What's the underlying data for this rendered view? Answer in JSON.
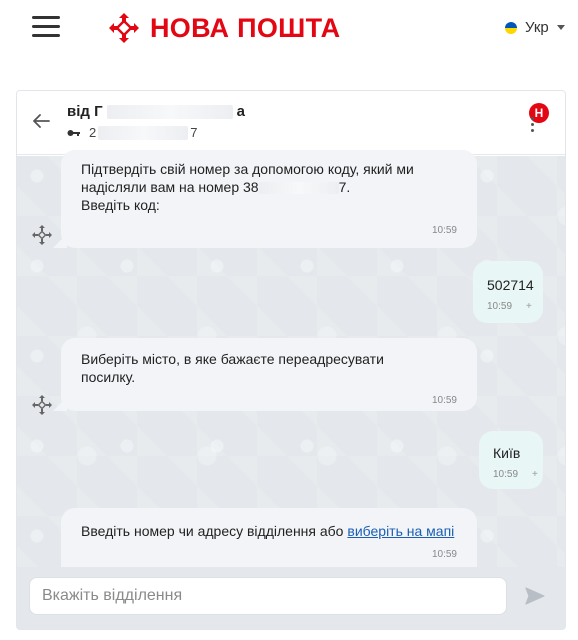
{
  "header": {
    "brand": "НОВА ПОШТА",
    "language": "Укр",
    "brand_color": "#e30613"
  },
  "chat": {
    "from_prefix": "від Г",
    "from_suffix": "а",
    "ttn_prefix": "2",
    "ttn_suffix": "7",
    "badge": "Н",
    "messages": [
      {
        "line1": "Підтвердіть свій номер за допомогою коду, який ми",
        "line2_prefix": "надісляли вам на номер 38",
        "line2_suffix": "7.",
        "line3": "Введіть код:",
        "time": "10:59"
      },
      {
        "text": "502714",
        "time": "10:59",
        "status": "+"
      },
      {
        "line1": "Виберіть місто, в яке бажаєте переадресувати",
        "line2": "посилку.",
        "time": "10:59"
      },
      {
        "text": "Київ",
        "time": "10:59",
        "status": "+"
      },
      {
        "text_prefix": "Введіть номер чи адресу відділення або ",
        "link": "виберіть на мапі",
        "time": "10:59"
      }
    ],
    "input_placeholder": "Вкажіть відділення"
  }
}
